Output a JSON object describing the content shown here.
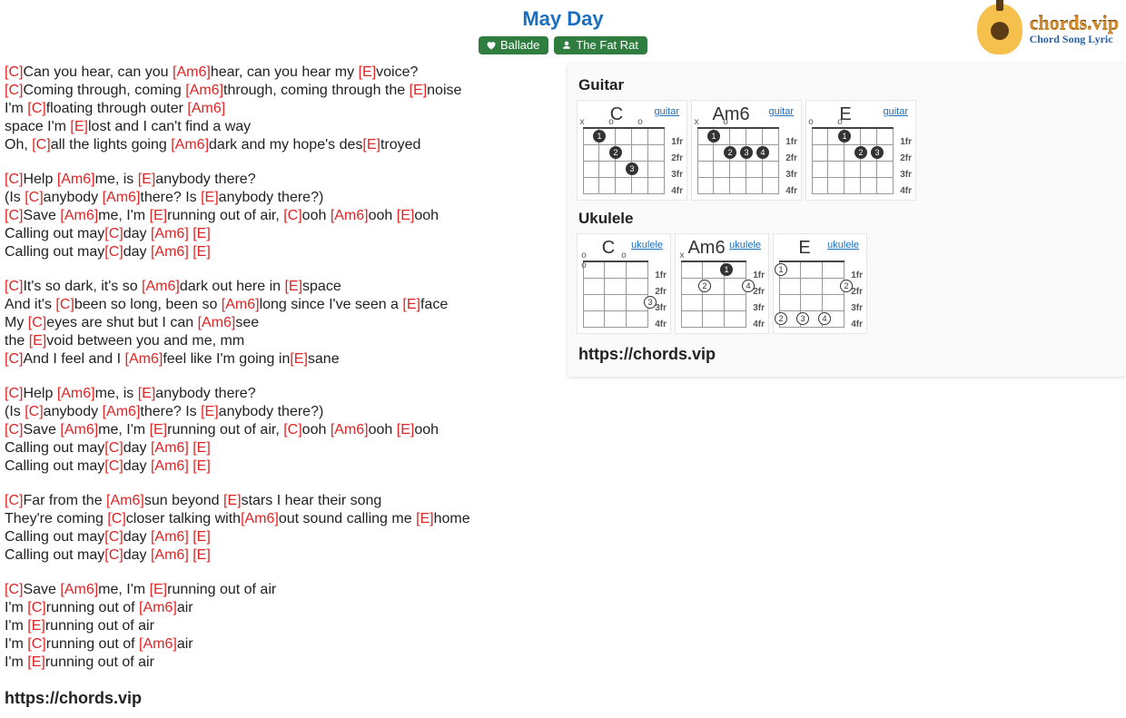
{
  "header": {
    "title": "May Day",
    "badge_genre": "Ballade",
    "badge_artist": "The Fat Rat"
  },
  "logo": {
    "line1": "chords.vip",
    "line2": "Chord Song Lyric"
  },
  "chords": {
    "C": "[C]",
    "Am6": "[Am6]",
    "E": "[E]"
  },
  "lyrics_url": "https://chords.vip",
  "side": {
    "guitar_title": "Guitar",
    "ukulele_title": "Ukulele",
    "guitar_link": "guitar",
    "ukulele_link": "ukulele",
    "url": "https://chords.vip",
    "frets": [
      "1fr",
      "2fr",
      "3fr",
      "4fr"
    ],
    "diagrams": {
      "guitar": [
        {
          "name": "C",
          "markers": "x   o o",
          "dots": [
            {
              "s": 1,
              "f": 1,
              "n": "1"
            },
            {
              "s": 2,
              "f": 2,
              "n": "2"
            },
            {
              "s": 3,
              "f": 3,
              "n": "3"
            }
          ]
        },
        {
          "name": "Am6",
          "markers": "x   o  ",
          "dots": [
            {
              "s": 1,
              "f": 1,
              "n": "1"
            },
            {
              "s": 2,
              "f": 2,
              "n": "2"
            },
            {
              "s": 3,
              "f": 2,
              "n": "3"
            },
            {
              "s": 4,
              "f": 2,
              "n": "4"
            }
          ]
        },
        {
          "name": "E",
          "markers": "o     o",
          "dots": [
            {
              "s": 2,
              "f": 1,
              "n": "1"
            },
            {
              "s": 3,
              "f": 2,
              "n": "2"
            },
            {
              "s": 4,
              "f": 2,
              "n": "3"
            }
          ]
        }
      ],
      "ukulele": [
        {
          "name": "C",
          "markers": "o o o",
          "dots": [
            {
              "s": 3,
              "f": 3,
              "n": "3",
              "w": true
            }
          ]
        },
        {
          "name": "Am6",
          "markers": "x    ",
          "dots": [
            {
              "s": 1,
              "f": 2,
              "n": "2",
              "w": true
            },
            {
              "s": 2,
              "f": 1,
              "n": "1",
              "w": false
            },
            {
              "s": 3,
              "f": 2,
              "n": "4",
              "w": true
            }
          ]
        },
        {
          "name": "E",
          "markers": "    ",
          "dots": [
            {
              "s": 0,
              "f": 1,
              "n": "1",
              "w": true
            },
            {
              "s": 3,
              "f": 2,
              "n": "2",
              "w": true
            },
            {
              "s": 0,
              "f": 4,
              "n": "2",
              "w": true
            },
            {
              "s": 1,
              "f": 4,
              "n": "3",
              "w": true
            },
            {
              "s": 2,
              "f": 4,
              "n": "4",
              "w": true
            }
          ]
        }
      ]
    }
  },
  "lyrics": [
    [
      [
        [
          "c",
          "C"
        ],
        "Can you hear, can you ",
        [
          "c",
          "Am6"
        ],
        "hear, can you hear my ",
        [
          "c",
          "E"
        ],
        "voice?"
      ],
      [
        [
          "c",
          "C"
        ],
        "Coming through, coming ",
        [
          "c",
          "Am6"
        ],
        "through, coming through the ",
        [
          "c",
          "E"
        ],
        "noise"
      ],
      [
        "I'm ",
        [
          "c",
          "C"
        ],
        "floating through outer ",
        [
          "c",
          "Am6"
        ]
      ],
      [
        "space I'm ",
        [
          "c",
          "E"
        ],
        "lost and I can't find a way"
      ],
      [
        "Oh, ",
        [
          "c",
          "C"
        ],
        "all the lights going ",
        [
          "c",
          "Am6"
        ],
        "dark and my hope's des",
        [
          "c",
          "E"
        ],
        "troyed"
      ]
    ],
    [
      [
        [
          "c",
          "C"
        ],
        "Help ",
        [
          "c",
          "Am6"
        ],
        "me, is ",
        [
          "c",
          "E"
        ],
        "anybody there?"
      ],
      [
        "(Is ",
        [
          "c",
          "C"
        ],
        "anybody ",
        [
          "c",
          "Am6"
        ],
        "there? Is ",
        [
          "c",
          "E"
        ],
        "anybody there?)"
      ],
      [
        [
          "c",
          "C"
        ],
        "Save ",
        [
          "c",
          "Am6"
        ],
        "me, I'm ",
        [
          "c",
          "E"
        ],
        "running out of air, ",
        [
          "c",
          "C"
        ],
        "ooh ",
        [
          "c",
          "Am6"
        ],
        "ooh ",
        [
          "c",
          "E"
        ],
        "ooh"
      ],
      [
        "Calling out may",
        [
          "c",
          "C"
        ],
        "day ",
        [
          "c",
          "Am6"
        ],
        " ",
        [
          "c",
          "E"
        ]
      ],
      [
        "Calling out may",
        [
          "c",
          "C"
        ],
        "day ",
        [
          "c",
          "Am6"
        ],
        " ",
        [
          "c",
          "E"
        ]
      ]
    ],
    [
      [
        [
          "c",
          "C"
        ],
        "It's so dark, it's so ",
        [
          "c",
          "Am6"
        ],
        "dark out here in ",
        [
          "c",
          "E"
        ],
        "space"
      ],
      [
        "And it's ",
        [
          "c",
          "C"
        ],
        "been so long, been so ",
        [
          "c",
          "Am6"
        ],
        "long since I've seen a ",
        [
          "c",
          "E"
        ],
        "face"
      ],
      [
        "My ",
        [
          "c",
          "C"
        ],
        "eyes are shut but I can ",
        [
          "c",
          "Am6"
        ],
        "see"
      ],
      [
        "the ",
        [
          "c",
          "E"
        ],
        "void between you and me, mm"
      ],
      [
        [
          "c",
          "C"
        ],
        "And I feel and I ",
        [
          "c",
          "Am6"
        ],
        "feel like I'm going in",
        [
          "c",
          "E"
        ],
        "sane"
      ]
    ],
    [
      [
        [
          "c",
          "C"
        ],
        "Help ",
        [
          "c",
          "Am6"
        ],
        "me, is ",
        [
          "c",
          "E"
        ],
        "anybody there?"
      ],
      [
        "(Is ",
        [
          "c",
          "C"
        ],
        "anybody ",
        [
          "c",
          "Am6"
        ],
        "there? Is ",
        [
          "c",
          "E"
        ],
        "anybody there?)"
      ],
      [
        [
          "c",
          "C"
        ],
        "Save ",
        [
          "c",
          "Am6"
        ],
        "me, I'm ",
        [
          "c",
          "E"
        ],
        "running out of air, ",
        [
          "c",
          "C"
        ],
        "ooh ",
        [
          "c",
          "Am6"
        ],
        "ooh ",
        [
          "c",
          "E"
        ],
        "ooh"
      ],
      [
        "Calling out may",
        [
          "c",
          "C"
        ],
        "day ",
        [
          "c",
          "Am6"
        ],
        " ",
        [
          "c",
          "E"
        ]
      ],
      [
        "Calling out may",
        [
          "c",
          "C"
        ],
        "day ",
        [
          "c",
          "Am6"
        ],
        " ",
        [
          "c",
          "E"
        ]
      ]
    ],
    [
      [
        [
          "c",
          "C"
        ],
        "Far from the ",
        [
          "c",
          "Am6"
        ],
        "sun beyond ",
        [
          "c",
          "E"
        ],
        "stars I hear their song"
      ],
      [
        "They're coming ",
        [
          "c",
          "C"
        ],
        "closer talking with",
        [
          "c",
          "Am6"
        ],
        "out sound calling me ",
        [
          "c",
          "E"
        ],
        "home"
      ],
      [
        "Calling out may",
        [
          "c",
          "C"
        ],
        "day ",
        [
          "c",
          "Am6"
        ],
        " ",
        [
          "c",
          "E"
        ]
      ],
      [
        "Calling out may",
        [
          "c",
          "C"
        ],
        "day ",
        [
          "c",
          "Am6"
        ],
        " ",
        [
          "c",
          "E"
        ]
      ]
    ],
    [
      [
        [
          "c",
          "C"
        ],
        "Save ",
        [
          "c",
          "Am6"
        ],
        "me, I'm ",
        [
          "c",
          "E"
        ],
        "running out of air"
      ],
      [
        "I'm ",
        [
          "c",
          "C"
        ],
        "running out of ",
        [
          "c",
          "Am6"
        ],
        "air"
      ],
      [
        "I'm ",
        [
          "c",
          "E"
        ],
        "running out of air"
      ],
      [
        "I'm ",
        [
          "c",
          "C"
        ],
        "running out of ",
        [
          "c",
          "Am6"
        ],
        "air"
      ],
      [
        "I'm ",
        [
          "c",
          "E"
        ],
        "running out of air"
      ]
    ]
  ]
}
